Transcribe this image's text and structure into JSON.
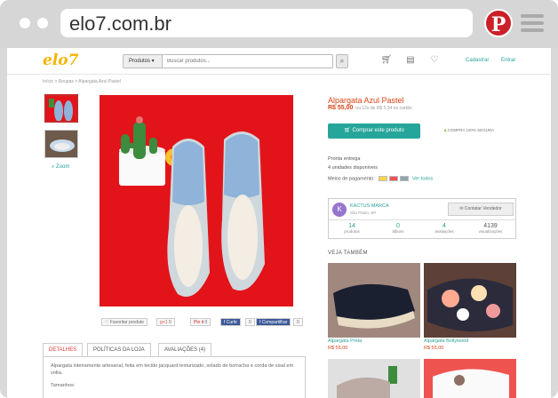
{
  "browser": {
    "url": "elo7.com.br",
    "pinterest_glyph": "P"
  },
  "site": {
    "logo": "elo7",
    "search_category": "Produtos",
    "search_placeholder": "Buscar produtos...",
    "cadastrar": "Cadastrar",
    "entrar": "Entrar",
    "icons": [
      "search-icon",
      "cart-icon",
      "list-icon",
      "heart-icon"
    ]
  },
  "breadcrumb": "Início > Roupas > Alpargata Azul Pastel",
  "gallery": {
    "zoom_label": "Zoom"
  },
  "social": {
    "favoritar": "Favoritar produto",
    "gplus": "g+1",
    "gplus_count": "0",
    "pinit": "Pin it",
    "pin_count": "0",
    "curtir": "Curtir",
    "curtir_count": "0",
    "compartilhar": "Compartilhar",
    "compartilhar_count": "0"
  },
  "tabs": {
    "detalhes": "DETALHES",
    "politicas": "POLÍTICAS DA LOJA",
    "avaliacoes": "AVALIAÇÕES (4)",
    "body_line1": "Alpargata inteiramente artesanal, feita em tecido jacquard texturizado, solado de borracha e corda de sisal em volta.",
    "body_line2": "Tamanhos:"
  },
  "product": {
    "title": "Alpargata Azul Pastel",
    "price": "R$ 55,00",
    "installments": "ou 12x de R$ 5,34 no cartão",
    "buy_button": "Comprar este produto",
    "secure": "COMPRA 100% SEGURA",
    "ready": "Pronta entrega",
    "stock": "4 unidades disponíveis",
    "payment_label": "Meios de pagamento:",
    "see_all": "Ver todos"
  },
  "seller": {
    "avatar_letter": "K",
    "name": "KACTUS MARCA",
    "location": "São Paulo, SP",
    "contact": "Contatar Vendedor",
    "stats": [
      {
        "num": "14",
        "label": "produtos"
      },
      {
        "num": "0",
        "label": "álbuns"
      },
      {
        "num": "4",
        "label": "avaliações"
      },
      {
        "num": "4139",
        "label": "visualizações"
      }
    ]
  },
  "related": {
    "heading": "VEJA TAMBÉM",
    "items": [
      {
        "name": "Alpargata Preta",
        "price": "R$ 55,00"
      },
      {
        "name": "Alpargata Bollywood",
        "price": "R$ 55,00"
      }
    ]
  },
  "colors": {
    "accent": "#2aa198",
    "price": "#d84315",
    "image_bg": "#e3131a",
    "shoe": "#8fb3d9"
  }
}
